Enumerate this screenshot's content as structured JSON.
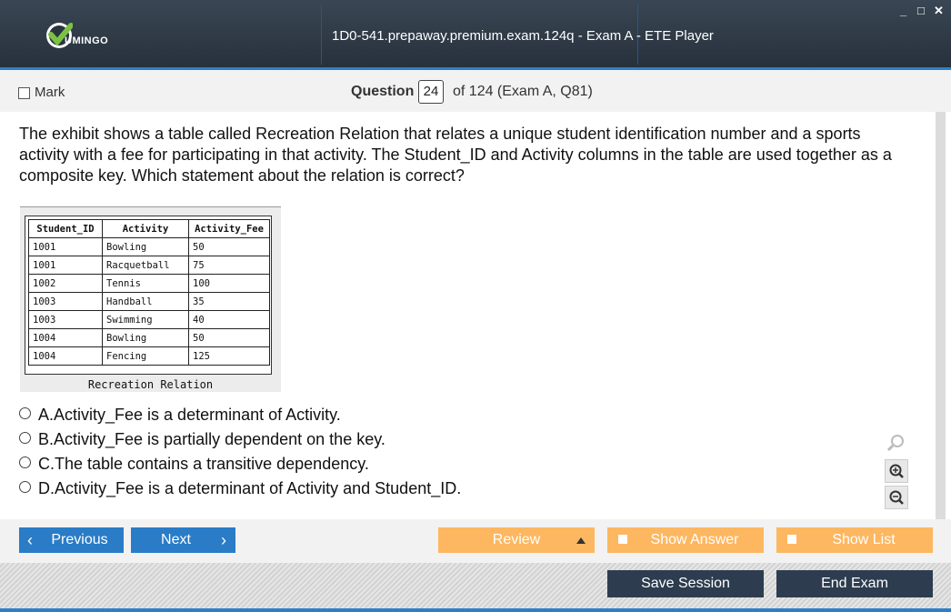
{
  "app": {
    "logo_text": "UMINGO",
    "title": "1D0-541.prepaway.premium.exam.124q - Exam A - ETE Player",
    "window_controls": [
      "_",
      "□",
      "✕"
    ]
  },
  "question_bar": {
    "mark_label": "Mark",
    "question_label": "Question",
    "question_number": "24",
    "of_text": "of 124 (Exam A, Q81)"
  },
  "question": {
    "text": "The exhibit shows a table called Recreation Relation that relates a unique student identification number and a sports activity with a fee for participating in that activity. The Student_ID and Activity columns in the table are used together as a composite key. Which statement about the relation is correct?"
  },
  "exhibit": {
    "headers": [
      "Student_ID",
      "Activity",
      "Activity_Fee"
    ],
    "rows": [
      [
        "1001",
        "Bowling",
        "50"
      ],
      [
        "1001",
        "Racquetball",
        "75"
      ],
      [
        "1002",
        "Tennis",
        "100"
      ],
      [
        "1003",
        "Handball",
        "35"
      ],
      [
        "1003",
        "Swimming",
        "40"
      ],
      [
        "1004",
        "Bowling",
        "50"
      ],
      [
        "1004",
        "Fencing",
        "125"
      ]
    ],
    "caption": "Recreation Relation"
  },
  "options": [
    {
      "letter": "A.",
      "text": "Activity_Fee is a determinant of Activity."
    },
    {
      "letter": "B.",
      "text": "Activity_Fee is partially dependent on the key."
    },
    {
      "letter": "C.",
      "text": "The table contains a transitive dependency."
    },
    {
      "letter": "D.",
      "text": "Activity_Fee is a determinant of Activity and Student_ID."
    }
  ],
  "zoom_icons": [
    "search-icon",
    "zoom-in-icon",
    "zoom-out-icon"
  ],
  "nav": {
    "previous": "Previous",
    "next": "Next",
    "review": "Review",
    "show_answer": "Show Answer",
    "show_list": "Show List",
    "save_session": "Save Session",
    "end_exam": "End Exam"
  },
  "colors": {
    "accent_blue": "#2a7cc7",
    "orange": "#fdb761",
    "dark": "#2d3d4f",
    "titlebar": "#2f3a46"
  }
}
